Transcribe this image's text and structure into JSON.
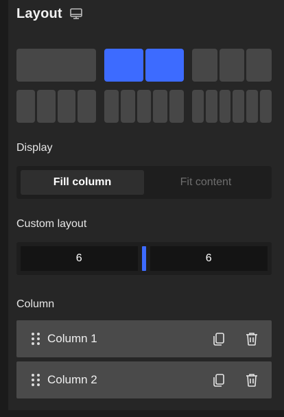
{
  "header": {
    "title": "Layout",
    "icon": "monitor-icon"
  },
  "presets": {
    "rows": [
      [
        {
          "segments": 1,
          "active": false
        },
        {
          "segments": 2,
          "active": true
        },
        {
          "segments": 3,
          "active": false
        }
      ],
      [
        {
          "segments": 4,
          "active": false
        },
        {
          "segments": 5,
          "active": false
        },
        {
          "segments": 6,
          "active": false
        }
      ]
    ]
  },
  "display": {
    "label": "Display",
    "options": [
      "Fill column",
      "Fit content"
    ],
    "selected": "Fill column"
  },
  "custom_layout": {
    "label": "Custom layout",
    "left_value": "6",
    "right_value": "6"
  },
  "columns": {
    "label": "Column",
    "items": [
      {
        "label": "Column 1"
      },
      {
        "label": "Column 2"
      }
    ]
  },
  "colors": {
    "accent": "#3d6bff",
    "panel": "#262626",
    "tile": "#474747"
  }
}
